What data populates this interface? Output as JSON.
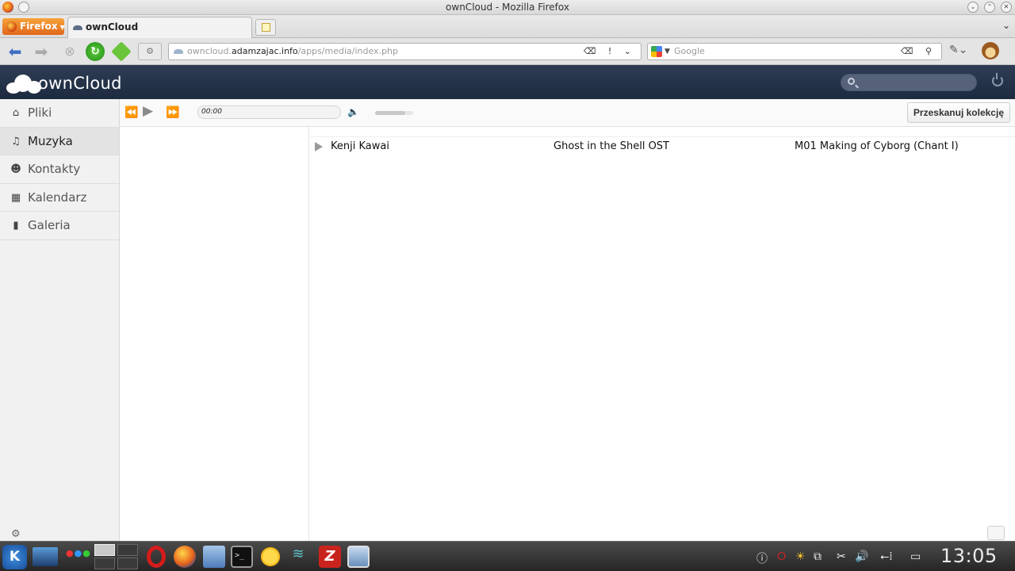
{
  "window": {
    "title": "ownCloud - Mozilla Firefox"
  },
  "browser": {
    "menu_label": "Firefox",
    "tab_title": "ownCloud",
    "url_prefix": "owncloud.",
    "url_domain": "adamzajac.info",
    "url_path": "/apps/media/index.php",
    "search_placeholder": "Google"
  },
  "owncloud": {
    "logo_text": "ownCloud",
    "search_placeholder": ""
  },
  "sidebar": {
    "items": [
      {
        "label": "Pliki",
        "icon": "folder-icon",
        "glyph": "▲",
        "active": false
      },
      {
        "label": "Muzyka",
        "icon": "music-icon",
        "glyph": "♫",
        "active": true
      },
      {
        "label": "Kontakty",
        "icon": "contacts-icon",
        "glyph": "☻",
        "active": false
      },
      {
        "label": "Kalendarz",
        "icon": "calendar-icon",
        "glyph": "▦",
        "active": false
      },
      {
        "label": "Galeria",
        "icon": "gallery-icon",
        "glyph": "▮",
        "active": false
      }
    ]
  },
  "player": {
    "time": "00:00",
    "volume_fraction": 0.8,
    "rescan_label": "Przeskanuj kolekcję"
  },
  "playlist": {
    "rows": [
      {
        "artist": "Kenji Kawai",
        "album": "Ghost in the Shell OST",
        "title": "M01 Making of Cyborg (Chant I)"
      }
    ]
  },
  "taskbar": {
    "clock": "13:05"
  }
}
